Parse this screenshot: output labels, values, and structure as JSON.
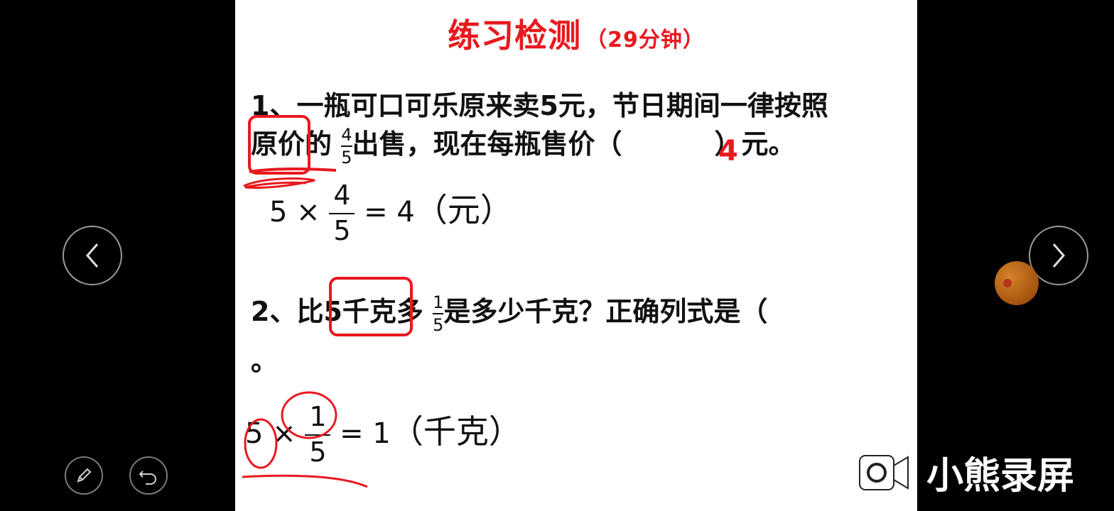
{
  "slide": {
    "title": "练习检测",
    "title_sub": "（29分钟）",
    "q1": {
      "line1": "1、一瓶可口可乐原来卖5元，节日期间一律按照",
      "before_frac": "原价的 ",
      "frac_num": "4",
      "frac_den": "5",
      "after_frac": "出售，现在每瓶售价（",
      "close": "）元。",
      "answer": "4"
    },
    "work1": {
      "left": "5 × ",
      "num": "4",
      "den": "5",
      "right": " = 4",
      "unit": "（元）"
    },
    "q2": {
      "before_frac": "2、比5千克多 ",
      "frac_num": "1",
      "frac_den": "5",
      "after_frac": "是多少千克？正确列式是（",
      "line2": "。"
    },
    "work2": {
      "left": "5 × ",
      "num": "1",
      "den": "5",
      "right": " = 1",
      "unit": "（千克）"
    }
  },
  "watermark": {
    "text": "小熊录屏"
  },
  "icons": {
    "prev": "chevron-left-icon",
    "next": "chevron-right-icon",
    "pen": "pen-icon",
    "undo": "undo-icon",
    "record": "record-camera-icon"
  },
  "colors": {
    "accent": "#e8191f",
    "background": "#000000",
    "slide": "#ffffff"
  }
}
